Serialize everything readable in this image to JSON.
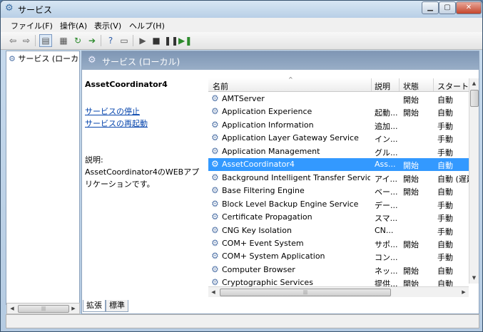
{
  "window": {
    "title": "サービス"
  },
  "menu": [
    "ファイル(F)",
    "操作(A)",
    "表示(V)",
    "ヘルプ(H)"
  ],
  "tree": {
    "item": "サービス (ローカル)"
  },
  "main": {
    "header_title": "サービス (ローカル)",
    "selected_name": "AssetCoordinator4",
    "links": [
      "サービスの停止",
      "サービスの再起動"
    ],
    "desc_label": "説明:",
    "desc_text": "AssetCoordinator4のWEBアプリケーションです。"
  },
  "columns": [
    "名前",
    "説明",
    "状態",
    "スタート..."
  ],
  "services": [
    {
      "name": "AMTServer",
      "desc": "",
      "status": "開始",
      "startup": "自動"
    },
    {
      "name": "Application Experience",
      "desc": "起動...",
      "status": "開始",
      "startup": "自動"
    },
    {
      "name": "Application Information",
      "desc": "追加...",
      "status": "",
      "startup": "手動"
    },
    {
      "name": "Application Layer Gateway Service",
      "desc": "イン...",
      "status": "",
      "startup": "手動"
    },
    {
      "name": "Application Management",
      "desc": "グル...",
      "status": "",
      "startup": "手動"
    },
    {
      "name": "AssetCoordinator4",
      "desc": "Ass...",
      "status": "開始",
      "startup": "自動",
      "selected": true
    },
    {
      "name": "Background Intelligent Transfer Service",
      "desc": "アイ...",
      "status": "開始",
      "startup": "自動 (遅延..."
    },
    {
      "name": "Base Filtering Engine",
      "desc": "ベー...",
      "status": "開始",
      "startup": "自動"
    },
    {
      "name": "Block Level Backup Engine Service",
      "desc": "デー...",
      "status": "",
      "startup": "手動"
    },
    {
      "name": "Certificate Propagation",
      "desc": "スマ...",
      "status": "",
      "startup": "手動"
    },
    {
      "name": "CNG Key Isolation",
      "desc": "CN...",
      "status": "",
      "startup": "手動"
    },
    {
      "name": "COM+ Event System",
      "desc": "サポ...",
      "status": "開始",
      "startup": "自動"
    },
    {
      "name": "COM+ System Application",
      "desc": "コン...",
      "status": "",
      "startup": "手動"
    },
    {
      "name": "Computer Browser",
      "desc": "ネッ...",
      "status": "開始",
      "startup": "自動"
    },
    {
      "name": "Cryptographic Services",
      "desc": "提供...",
      "status": "開始",
      "startup": "自動"
    }
  ],
  "tabs": [
    "拡張",
    "標準"
  ]
}
